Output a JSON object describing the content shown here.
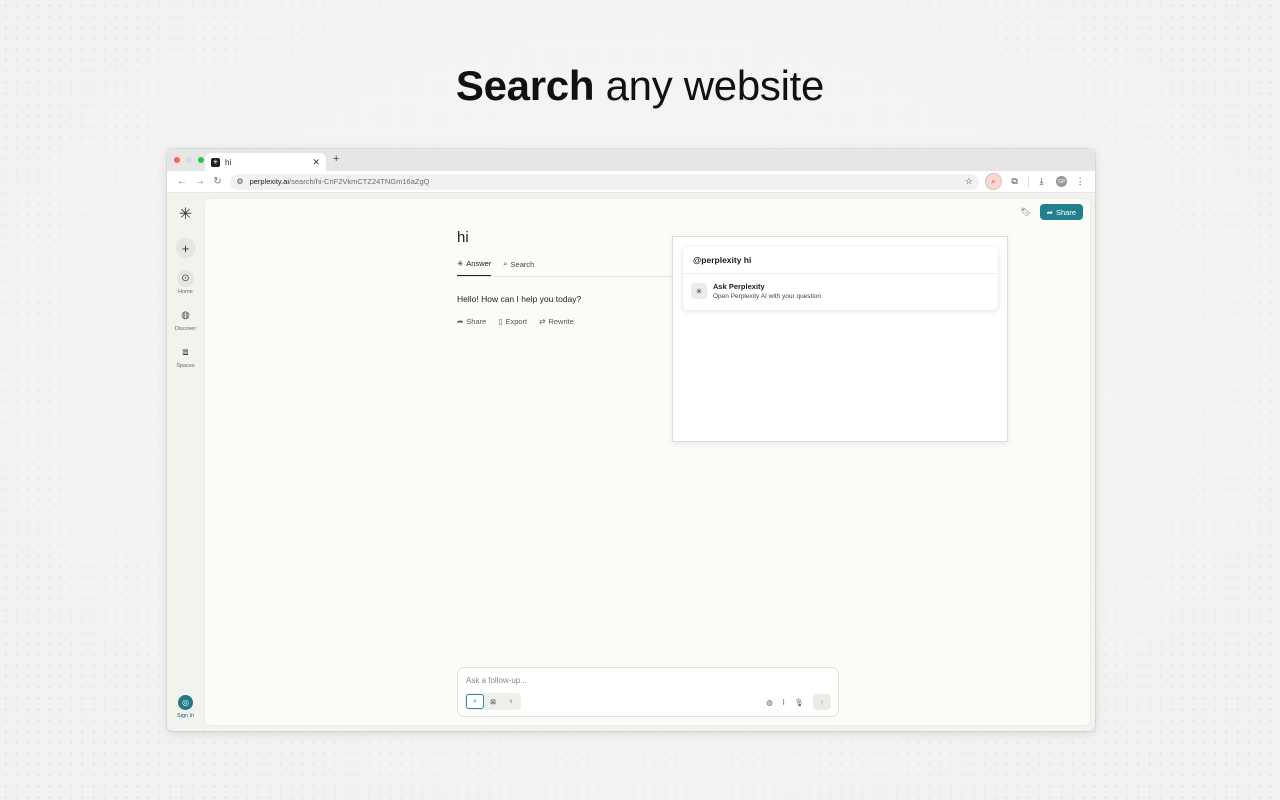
{
  "hero": {
    "bold": "Search",
    "rest": "any website"
  },
  "browser": {
    "tab_title": "hi",
    "tab_favicon": "perplexity-logo",
    "url_host": "perplexity.ai",
    "url_path": "/search/hi-CnF2VkmCTZ24TNGm16aZgQ",
    "profile_initials": "GP",
    "ext_icon": "perplexity-search-icon"
  },
  "sidebar": {
    "items": [
      {
        "label": "Home",
        "icon": "home-icon"
      },
      {
        "label": "Discover",
        "icon": "globe-icon"
      },
      {
        "label": "Spaces",
        "icon": "spaces-icon"
      }
    ],
    "signin_label": "Sign In"
  },
  "thread": {
    "title": "hi",
    "tabs": [
      {
        "label": "Answer"
      },
      {
        "label": "Search"
      }
    ],
    "answer": "Hello! How can I help you today?",
    "actions": [
      {
        "label": "Share"
      },
      {
        "label": "Export"
      },
      {
        "label": "Rewrite"
      }
    ],
    "share_button": "Share"
  },
  "followup": {
    "placeholder": "Ask a follow-up..."
  },
  "popup": {
    "query": "@perplexity hi",
    "item_title": "Ask Perplexity",
    "item_subtitle": "Open Perplexity AI with your question"
  },
  "colors": {
    "accent": "#21808d",
    "active_ext": "#c9472a"
  }
}
